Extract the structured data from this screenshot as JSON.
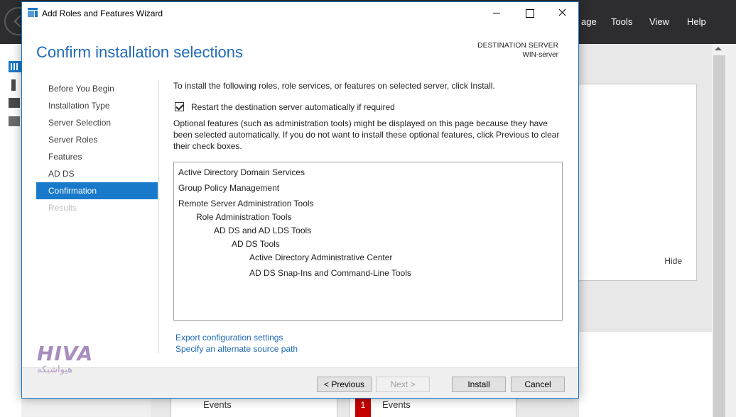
{
  "background": {
    "menu": [
      "age",
      "Tools",
      "View",
      "Help"
    ],
    "hide_label": "Hide",
    "tiles": [
      {
        "label": "Events"
      },
      {
        "label": "Events",
        "count": "1"
      }
    ]
  },
  "wizard": {
    "window_title": "Add Roles and Features Wizard",
    "heading": "Confirm installation selections",
    "destination_label": "DESTINATION SERVER",
    "destination_server": "WIN-server",
    "nav": [
      {
        "label": "Before You Begin",
        "state": "normal"
      },
      {
        "label": "Installation Type",
        "state": "normal"
      },
      {
        "label": "Server Selection",
        "state": "normal"
      },
      {
        "label": "Server Roles",
        "state": "normal"
      },
      {
        "label": "Features",
        "state": "normal"
      },
      {
        "label": "AD DS",
        "state": "normal"
      },
      {
        "label": "Confirmation",
        "state": "active"
      },
      {
        "label": "Results",
        "state": "disabled"
      }
    ],
    "intro": "To install the following roles, role services, or features on selected server, click Install.",
    "restart_checkbox": {
      "label": "Restart the destination server automatically if required",
      "checked": true
    },
    "optional_note": "Optional features (such as administration tools) might be displayed on this page because they have been selected automatically. If you do not want to install these optional features, click Previous to clear their check boxes.",
    "features": [
      {
        "label": "Active Directory Domain Services",
        "level": 0
      },
      {
        "label": "Group Policy Management",
        "level": 0
      },
      {
        "label": "Remote Server Administration Tools",
        "level": 0
      },
      {
        "label": "Role Administration Tools",
        "level": 1
      },
      {
        "label": "AD DS and AD LDS Tools",
        "level": 2
      },
      {
        "label": "AD DS Tools",
        "level": 3
      },
      {
        "label": "Active Directory Administrative Center",
        "level": 4
      },
      {
        "label": "AD DS Snap-Ins and Command-Line Tools",
        "level": 4
      }
    ],
    "links": {
      "export": "Export configuration settings",
      "alternate_source": "Specify an alternate source path"
    },
    "buttons": {
      "previous": "< Previous",
      "next": "Next >",
      "install": "Install",
      "cancel": "Cancel"
    }
  },
  "watermark": {
    "logo": "HIVA",
    "subtitle": "هیواشبکه"
  },
  "colors": {
    "accent": "#1979ca",
    "heading": "#1f6ab6",
    "titlebar_dark": "#2d2d30",
    "badge_red": "#c40000"
  }
}
